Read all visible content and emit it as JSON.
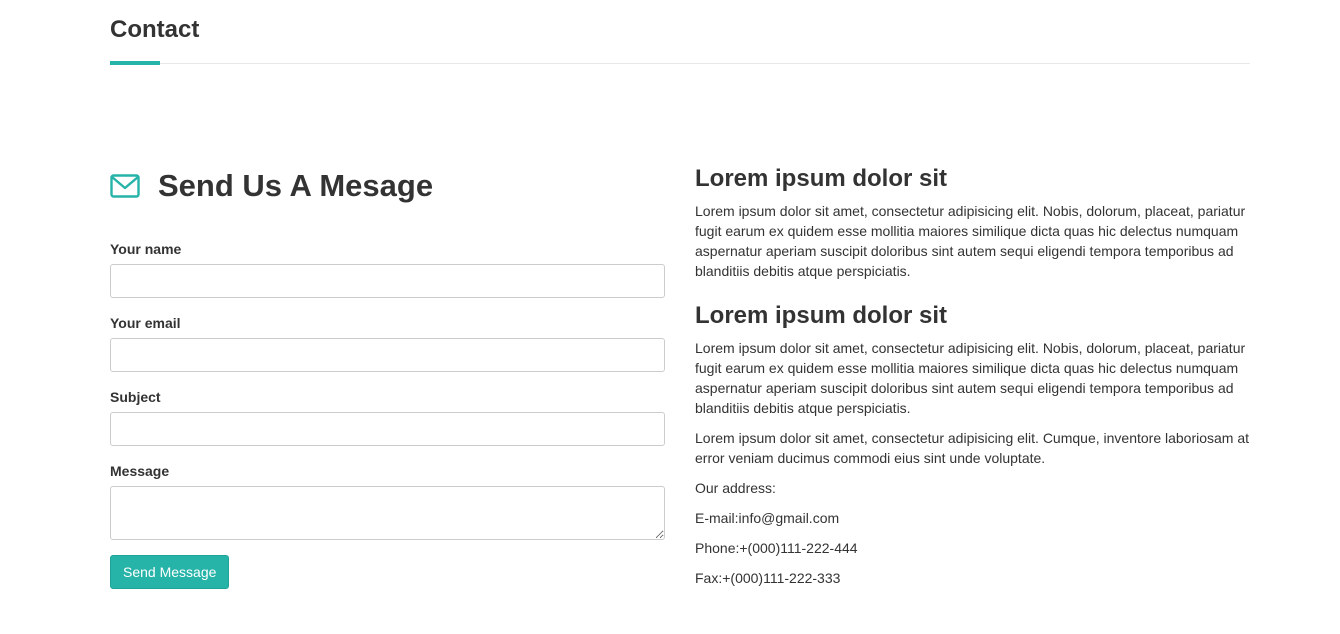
{
  "header": {
    "title": "Contact"
  },
  "colors": {
    "accent": "#26b3a8",
    "text": "#333333",
    "border": "#cccccc"
  },
  "form": {
    "icon": "envelope-icon",
    "heading": "Send Us A Mesage",
    "fields": [
      {
        "label": "Your name",
        "value": "",
        "placeholder": ""
      },
      {
        "label": "Your email",
        "value": "",
        "placeholder": ""
      },
      {
        "label": "Subject",
        "value": "",
        "placeholder": ""
      },
      {
        "label": "Message",
        "value": "",
        "placeholder": ""
      }
    ],
    "submit_label": "Send Message"
  },
  "info": {
    "sections": [
      {
        "title": "Lorem ipsum dolor sit",
        "text": "Lorem ipsum dolor sit amet, consectetur adipisicing elit. Nobis, dolorum, placeat, pariatur fugit earum ex quidem esse mollitia maiores similique dicta quas hic delectus numquam aspernatur aperiam suscipit doloribus sint autem sequi eligendi tempora temporibus ad blanditiis debitis atque perspiciatis."
      },
      {
        "title": "Lorem ipsum dolor sit",
        "text": "Lorem ipsum dolor sit amet, consectetur adipisicing elit. Nobis, dolorum, placeat, pariatur fugit earum ex quidem esse mollitia maiores similique dicta quas hic delectus numquam aspernatur aperiam suscipit doloribus sint autem sequi eligendi tempora temporibus ad blanditiis debitis atque perspiciatis."
      }
    ],
    "extra_text": "Lorem ipsum dolor sit amet, consectetur adipisicing elit. Cumque, inventore laboriosam at error veniam ducimus commodi eius sint unde voluptate.",
    "address_label": "Our address:",
    "email": "E-mail:info@gmail.com",
    "phone": "Phone:+(000)111-222-444",
    "fax": "Fax:+(000)111-222-333"
  }
}
